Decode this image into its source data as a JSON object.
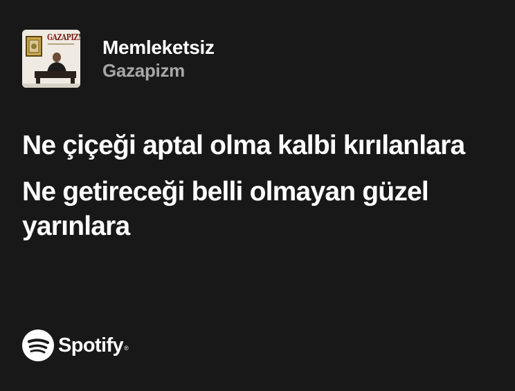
{
  "track": {
    "cover_icon": "album-cover-image",
    "cover_text": "GAZAPIZM",
    "title": "Memleketsiz",
    "artist": "Gazapizm"
  },
  "lyrics": {
    "lines": [
      "Ne çiçeği aptal olma kalbi kırılanlara",
      "Ne getireceği belli olmayan güzel yarınlara"
    ]
  },
  "brand": {
    "icon": "spotify-logo-icon",
    "name": "Spotify",
    "trademark": "®"
  },
  "colors": {
    "background": "#181818",
    "primary_text": "#ffffff",
    "secondary_text": "#a7a7a7"
  }
}
